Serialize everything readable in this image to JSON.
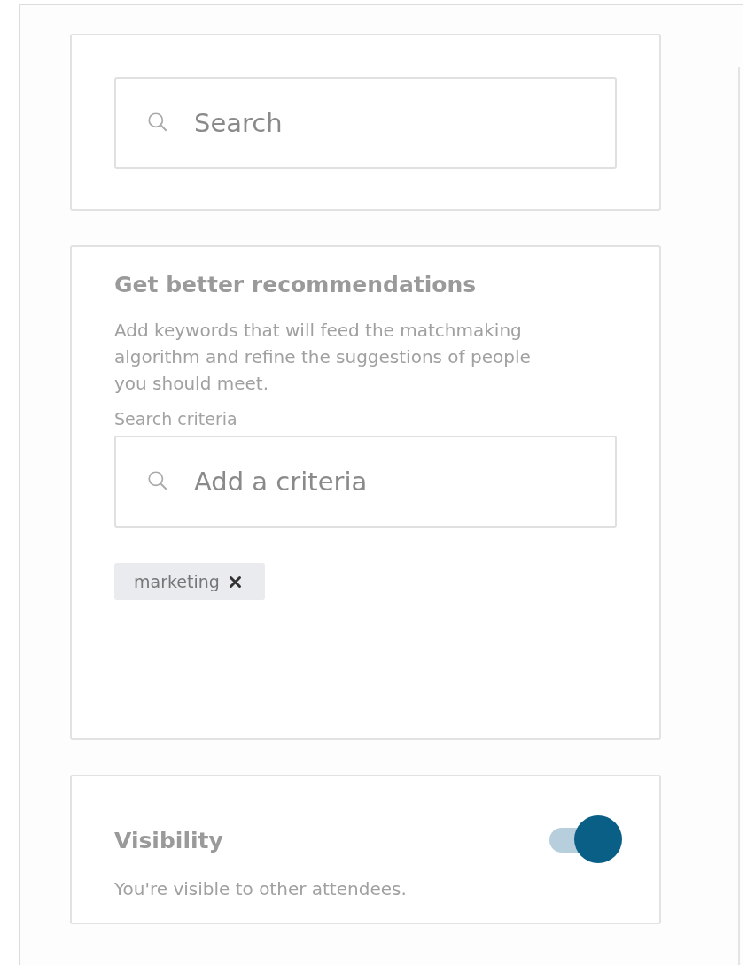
{
  "search": {
    "placeholder": "Search"
  },
  "recommendations": {
    "title": "Get better recommendations",
    "description": "Add keywords that will feed the matchmaking algorithm and refine the suggestions of people you should meet.",
    "criteria_label": "Search criteria",
    "criteria_field": {
      "placeholder": "Add a criteria"
    },
    "tags": [
      {
        "label": "marketing"
      }
    ]
  },
  "visibility": {
    "title": "Visibility",
    "description": "You're visible to other attendees.",
    "on": true
  }
}
